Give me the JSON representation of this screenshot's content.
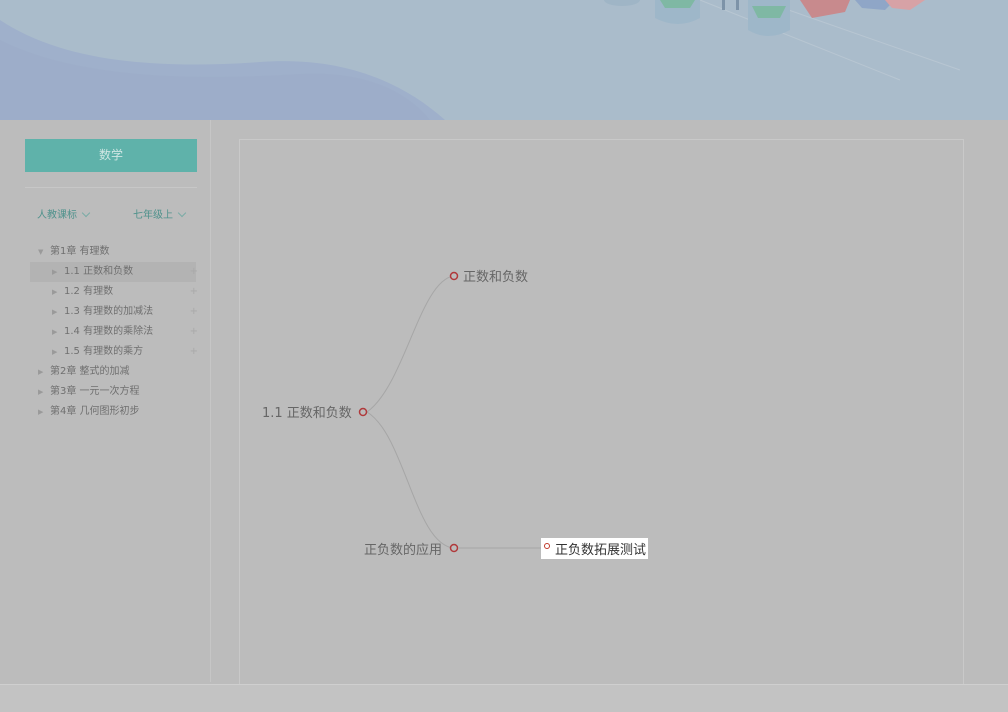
{
  "sidebar": {
    "subject_button": "数学",
    "edition_selector": "人教课标",
    "grade_selector": "七年级上",
    "tree": [
      {
        "label": "第1章 有理数",
        "level": 0,
        "expanded": true
      },
      {
        "label": "1.1 正数和负数",
        "level": 1,
        "active": true,
        "plus": "+"
      },
      {
        "label": "1.2 有理数",
        "level": 1,
        "plus": "+"
      },
      {
        "label": "1.3 有理数的加减法",
        "level": 1,
        "plus": "+"
      },
      {
        "label": "1.4 有理数的乘除法",
        "level": 1,
        "plus": "+"
      },
      {
        "label": "1.5 有理数的乘方",
        "level": 1,
        "plus": "+"
      },
      {
        "label": "第2章 整式的加减",
        "level": 0
      },
      {
        "label": "第3章 一元一次方程",
        "level": 0
      },
      {
        "label": "第4章 几何图形初步",
        "level": 0
      }
    ]
  },
  "mindmap": {
    "root": "1.1 正数和负数",
    "child_1": "正数和负数",
    "child_2": "正负数的应用",
    "leaf": "正负数拓展测试"
  },
  "colors": {
    "accent": "#5fb2aa",
    "node_dot": "#c0392b",
    "overlay": "#bcbcbc"
  }
}
